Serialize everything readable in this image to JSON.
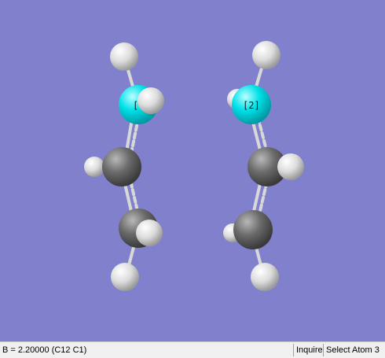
{
  "viewer": {
    "background_color": "#8080cc",
    "atom_labels": {
      "left_nitrogen": "[",
      "right_nitrogen": "[2]"
    },
    "colors": {
      "hydrogen": "#e8e8e8",
      "carbon": "#606060",
      "nitrogen": "#00e0e8"
    }
  },
  "status_bar": {
    "measurement": "B = 2.20000 (C12 C1)",
    "inquire_label": "Inquire",
    "select_atom_label": "Select Atom 3"
  }
}
